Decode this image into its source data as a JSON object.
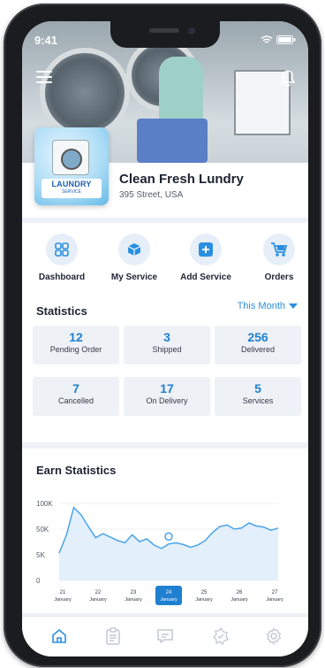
{
  "status_bar": {
    "time": "9:41"
  },
  "business": {
    "name": "Clean Fresh Lundry",
    "address": "395 Street, USA",
    "logo_text": "LAUNDRY",
    "logo_subtext": "SERVICE"
  },
  "actions": [
    {
      "label": "Dashboard",
      "icon": "dashboard-icon"
    },
    {
      "label": "My Service",
      "icon": "box-icon"
    },
    {
      "label": "Add Service",
      "icon": "plus-square-icon"
    },
    {
      "label": "Orders",
      "icon": "cart-icon"
    }
  ],
  "statistics": {
    "title": "Statistics",
    "period": "This Month",
    "cards": [
      {
        "value": "12",
        "label": "Pending Order"
      },
      {
        "value": "3",
        "label": "Shipped"
      },
      {
        "value": "256",
        "label": "Delivered"
      },
      {
        "value": "7",
        "label": "Cancelled"
      },
      {
        "value": "17",
        "label": "On Delivery"
      },
      {
        "value": "5",
        "label": "Services"
      }
    ]
  },
  "earn": {
    "title": "Earn Statistics"
  },
  "chart_data": {
    "type": "area",
    "title": "Earn Statistics",
    "y_tick_labels": [
      "100K",
      "50K",
      "5K",
      "0"
    ],
    "y_tick_values": [
      100000,
      50000,
      5000,
      0
    ],
    "categories": [
      {
        "day": "21",
        "month": "January"
      },
      {
        "day": "22",
        "month": "January"
      },
      {
        "day": "23",
        "month": "January"
      },
      {
        "day": "24",
        "month": "January"
      },
      {
        "day": "25",
        "month": "January"
      },
      {
        "day": "26",
        "month": "January"
      },
      {
        "day": "27",
        "month": "January"
      }
    ],
    "selected_index": 3,
    "series": [
      {
        "values": [
          8000,
          40000,
          92000,
          78000,
          55000,
          35000,
          42000,
          36000,
          30000,
          26000,
          40000,
          28000,
          33000,
          22000,
          16000,
          24000,
          26000,
          23000,
          18000,
          22000,
          30000,
          44000,
          55000,
          58000,
          50000,
          52000,
          62000,
          56000,
          54000,
          48000,
          52000
        ]
      }
    ],
    "marker_value": 37000,
    "colors": {
      "line": "#4aa3e8",
      "fill": "#dcecfb",
      "selected": "#1f7fd1"
    }
  },
  "tabbar": [
    {
      "icon": "home-icon",
      "active": true
    },
    {
      "icon": "clipboard-icon",
      "active": false
    },
    {
      "icon": "chat-icon",
      "active": false
    },
    {
      "icon": "badge-icon",
      "active": false
    },
    {
      "icon": "settings-icon",
      "active": false
    }
  ]
}
